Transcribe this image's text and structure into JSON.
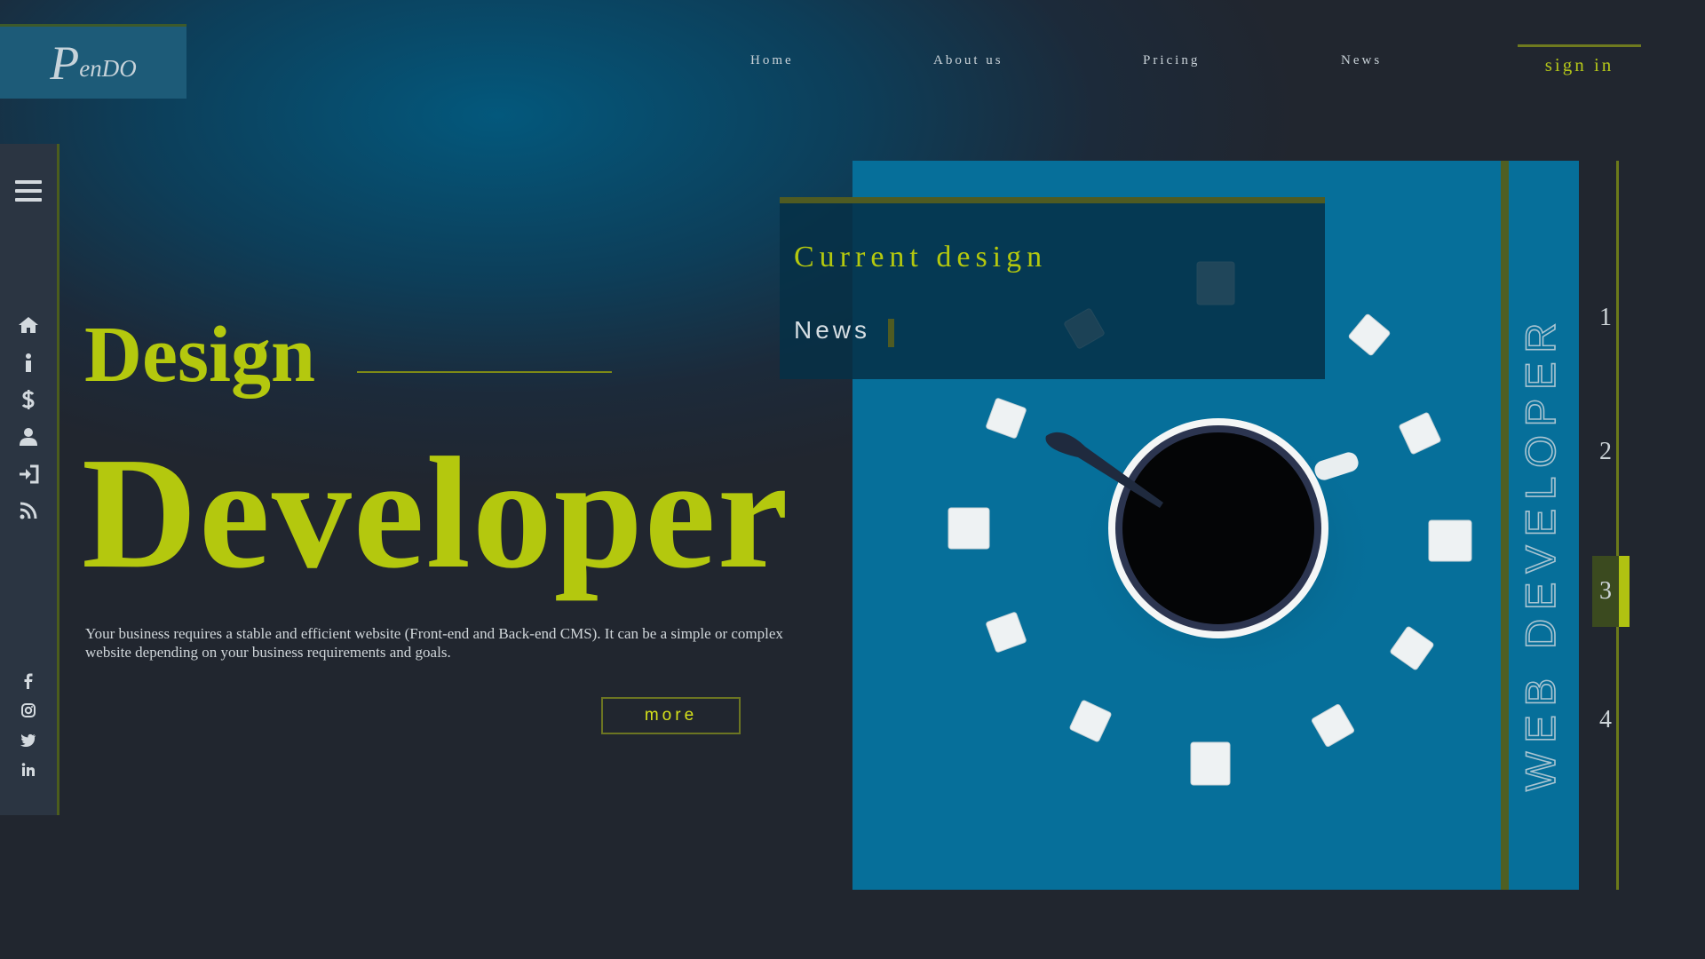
{
  "brand": {
    "logo_initial": "P",
    "logo_rest": "enDO"
  },
  "nav": {
    "items": [
      "Home",
      "About us",
      "Pricing",
      "News"
    ],
    "signin": "sign in"
  },
  "sidebar": {
    "menu_icon": "hamburger-menu-icon",
    "nav_icons": [
      "home-icon",
      "info-icon",
      "dollar-icon",
      "user-icon",
      "sign-in-icon",
      "rss-icon"
    ],
    "social_icons": [
      "facebook-icon",
      "instagram-icon",
      "twitter-icon",
      "linkedin-icon"
    ]
  },
  "hero": {
    "title_small": "Design",
    "title_big": "Developer",
    "description": "Your business requires a stable and efficient website (Front-end and Back-end CMS). It can be a simple or complex website depending on your business requirements and goals.",
    "more_label": "more"
  },
  "feature": {
    "panel_title": "Current design",
    "panel_subtitle": "News",
    "vertical_text": "WEB DEVELOPER"
  },
  "pager": {
    "pages": [
      "1",
      "2",
      "3",
      "4"
    ],
    "active": "3"
  },
  "colors": {
    "accent": "#b4c80e",
    "card": "#066f9a",
    "background": "#21262f",
    "sidebar": "#2b3542"
  }
}
